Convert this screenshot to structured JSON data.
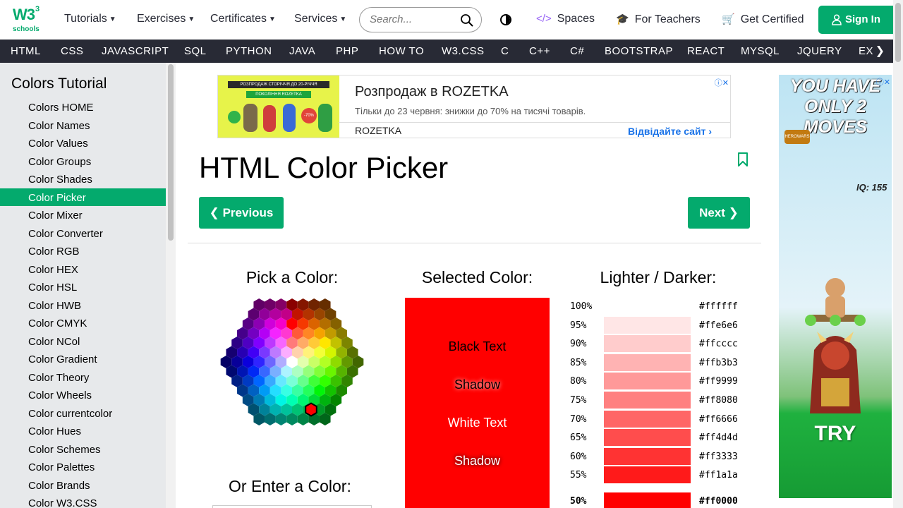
{
  "header": {
    "logo_main": "W3",
    "logo_sup": "3",
    "logo_sub": "schools",
    "menu": [
      "Tutorials",
      "Exercises",
      "Certificates",
      "Services"
    ],
    "search_placeholder": "Search...",
    "spaces": "Spaces",
    "for_teachers": "For Teachers",
    "get_certified": "Get Certified",
    "sign_in": "Sign In"
  },
  "topics": [
    "HTML",
    "CSS",
    "JAVASCRIPT",
    "SQL",
    "PYTHON",
    "JAVA",
    "PHP",
    "HOW TO",
    "W3.CSS",
    "C",
    "C++",
    "C#",
    "BOOTSTRAP",
    "REACT",
    "MYSQL",
    "JQUERY",
    "EX"
  ],
  "sidebar": {
    "title": "Colors Tutorial",
    "items": [
      "Colors HOME",
      "Color Names",
      "Color Values",
      "Color Groups",
      "Color Shades",
      "Color Picker",
      "Color Mixer",
      "Color Converter",
      "Color RGB",
      "Color HEX",
      "Color HSL",
      "Color HWB",
      "Color CMYK",
      "Color NCol",
      "Color Gradient",
      "Color Theory",
      "Color Wheels",
      "Color currentcolor",
      "Color Hues",
      "Color Schemes",
      "Color Palettes",
      "Color Brands",
      "Color W3.CSS"
    ],
    "active_index": 5
  },
  "ad": {
    "banner_top": "РОЗПРОДАЖ СТОРІЧЧЯ ДО 20-РІЧЧЯ",
    "banner_tag": "ПОКОЛІННЯ ROZETKA",
    "badge": "-70%",
    "title": "Розпродаж в ROZETKA",
    "desc": "Тільки до 23 червня: знижки до 70% на тисячі товарів.",
    "brand": "ROZETKA",
    "visit": "Відвідайте сайт"
  },
  "page": {
    "title": "HTML Color Picker",
    "prev": "Previous",
    "next": "Next"
  },
  "picker": {
    "pick_heading": "Pick a Color:",
    "selected_heading": "Selected Color:",
    "shades_heading": "Lighter / Darker:",
    "enter_heading": "Or Enter a Color:",
    "selected_color": "#ff0000",
    "black_text": "Black Text",
    "shadow1": "Shadow",
    "white_text": "White Text",
    "shadow2": "Shadow"
  },
  "shades": [
    {
      "pct": "100%",
      "hex": "#ffffff"
    },
    {
      "pct": "95%",
      "hex": "#ffe6e6"
    },
    {
      "pct": "90%",
      "hex": "#ffcccc"
    },
    {
      "pct": "85%",
      "hex": "#ffb3b3"
    },
    {
      "pct": "80%",
      "hex": "#ff9999"
    },
    {
      "pct": "75%",
      "hex": "#ff8080"
    },
    {
      "pct": "70%",
      "hex": "#ff6666"
    },
    {
      "pct": "65%",
      "hex": "#ff4d4d"
    },
    {
      "pct": "60%",
      "hex": "#ff3333"
    },
    {
      "pct": "55%",
      "hex": "#ff1a1a"
    },
    {
      "pct": "50%",
      "hex": "#ff0000"
    }
  ],
  "right_ad": {
    "headline": "YOU HAVE ONLY 2 MOVES",
    "logo": "HEROWARS",
    "iq": "IQ: 155",
    "cta": "TRY"
  },
  "colors": {
    "brand_green": "#04AA6D",
    "dark_nav": "#282A35",
    "sidebar_bg": "#E7E9EB",
    "accent_purple": "#9763F6"
  }
}
